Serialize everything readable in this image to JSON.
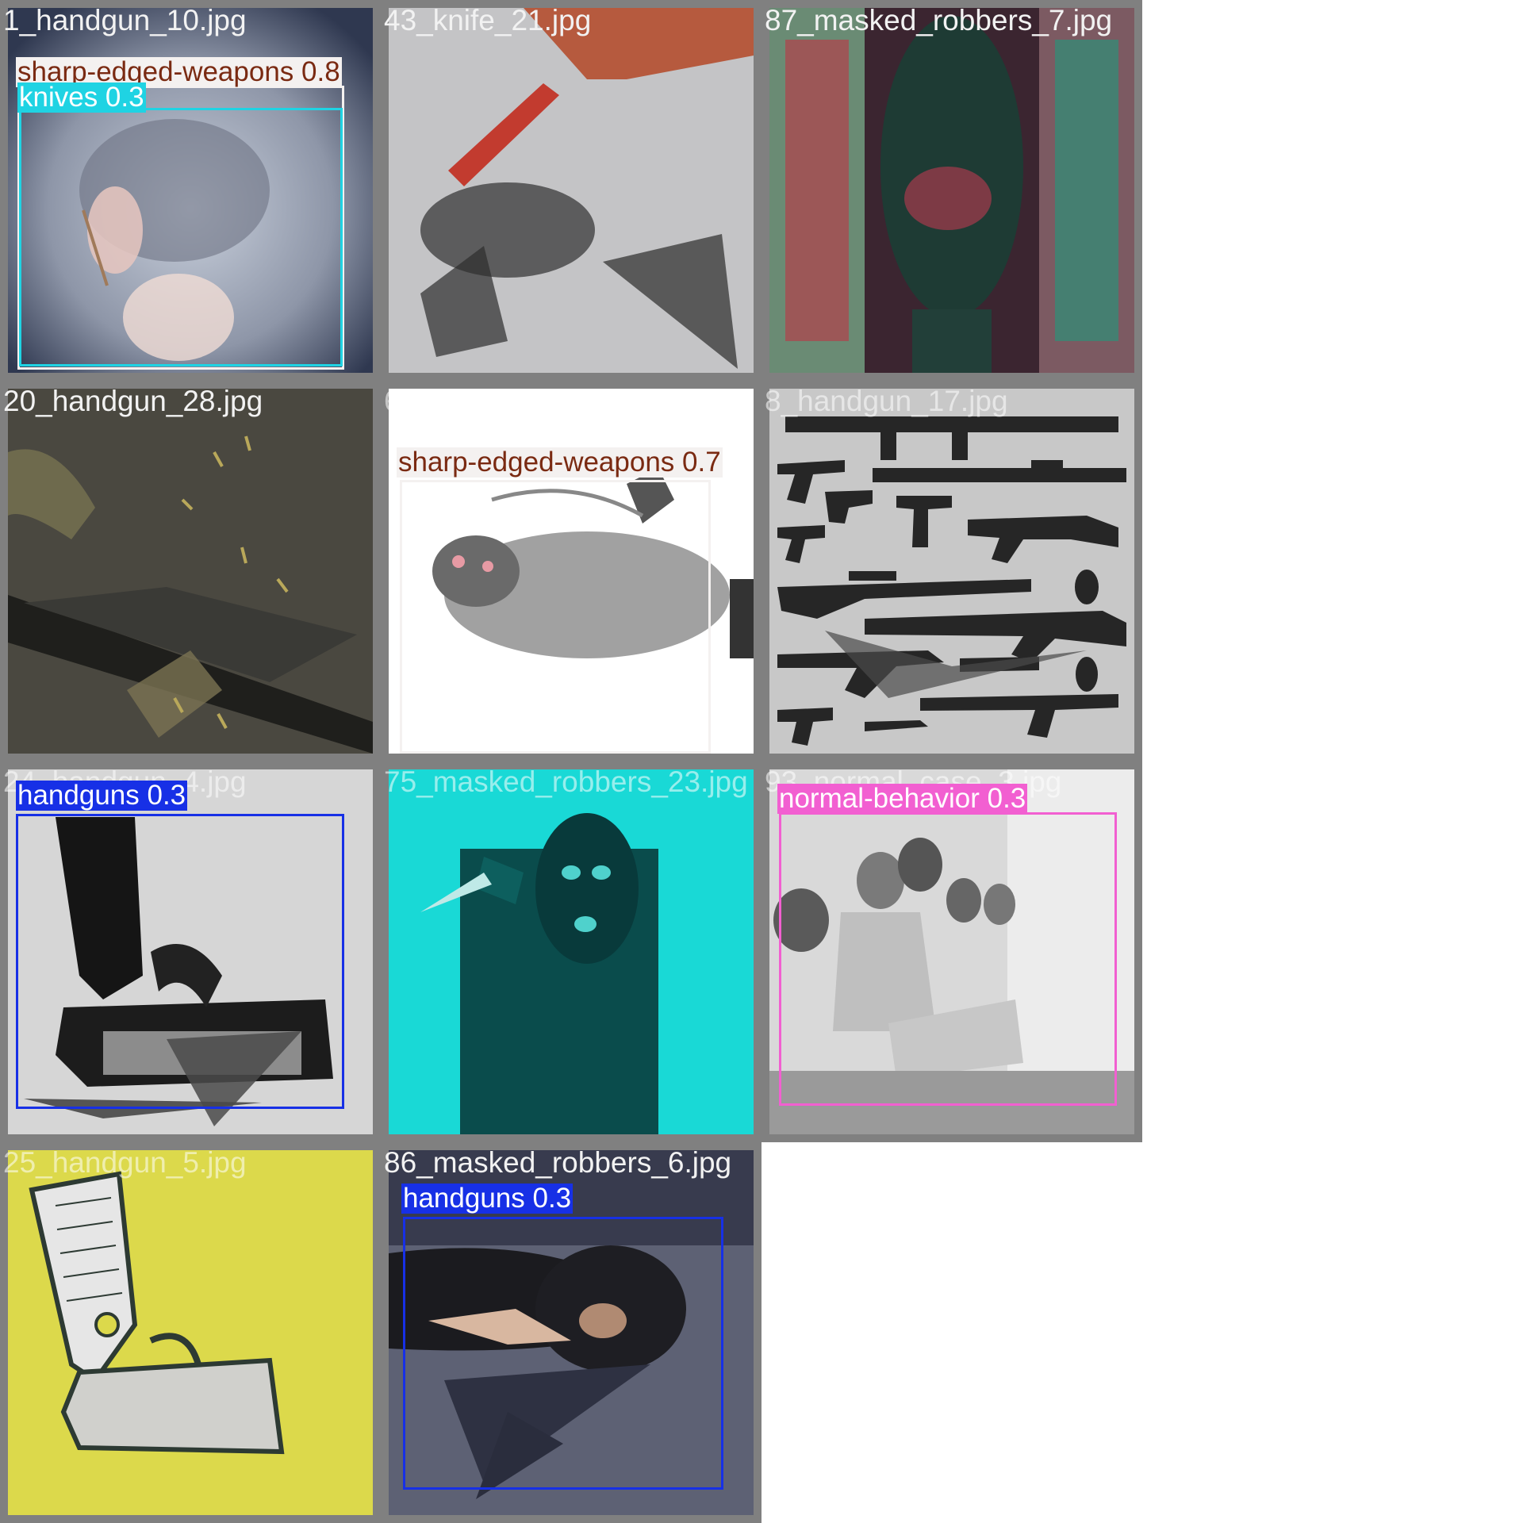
{
  "colors": {
    "tile_border": "#808080",
    "knives": "#1fd3e3",
    "sharp_edged_weapons": "#f4f1f0",
    "sharp_edged_weapons_text": "#7a2a12",
    "handguns": "#1730e6",
    "normal_behavior": "#f25fd1"
  },
  "tiles": [
    {
      "filename": "1_handgun_10.jpg",
      "detections": [
        {
          "label": "sharp-edged-weapons 0.8",
          "class": "sharp-edged-weapons",
          "confidence": 0.8
        },
        {
          "label": "knives 0.3",
          "class": "knives",
          "confidence": 0.3
        }
      ]
    },
    {
      "filename": "43_knife_21.jpg",
      "detections": []
    },
    {
      "filename": "87_masked_robbers_7.jpg",
      "detections": []
    },
    {
      "filename": "20_handgun_28.jpg",
      "detections": []
    },
    {
      "filename": "60_masked_robbers_1.jpg",
      "detections": [
        {
          "label": "sharp-edged-weapons 0.7",
          "class": "sharp-edged-weapons",
          "confidence": 0.7
        }
      ]
    },
    {
      "filename": "8_handgun_17.jpg",
      "detections": []
    },
    {
      "filename": "24_handgun_4.jpg",
      "detections": [
        {
          "label": "handguns 0.3",
          "class": "handguns",
          "confidence": 0.3
        }
      ]
    },
    {
      "filename": "75_masked_robbers_23.jpg",
      "detections": []
    },
    {
      "filename": "93_normal_case_3.jpg",
      "detections": [
        {
          "label": "normal-behavior 0.3",
          "class": "normal-behavior",
          "confidence": 0.3
        }
      ]
    },
    {
      "filename": "25_handgun_5.jpg",
      "detections": []
    },
    {
      "filename": "86_masked_robbers_6.jpg",
      "detections": [
        {
          "label": "handguns 0.3",
          "class": "handguns",
          "confidence": 0.3
        }
      ]
    }
  ]
}
